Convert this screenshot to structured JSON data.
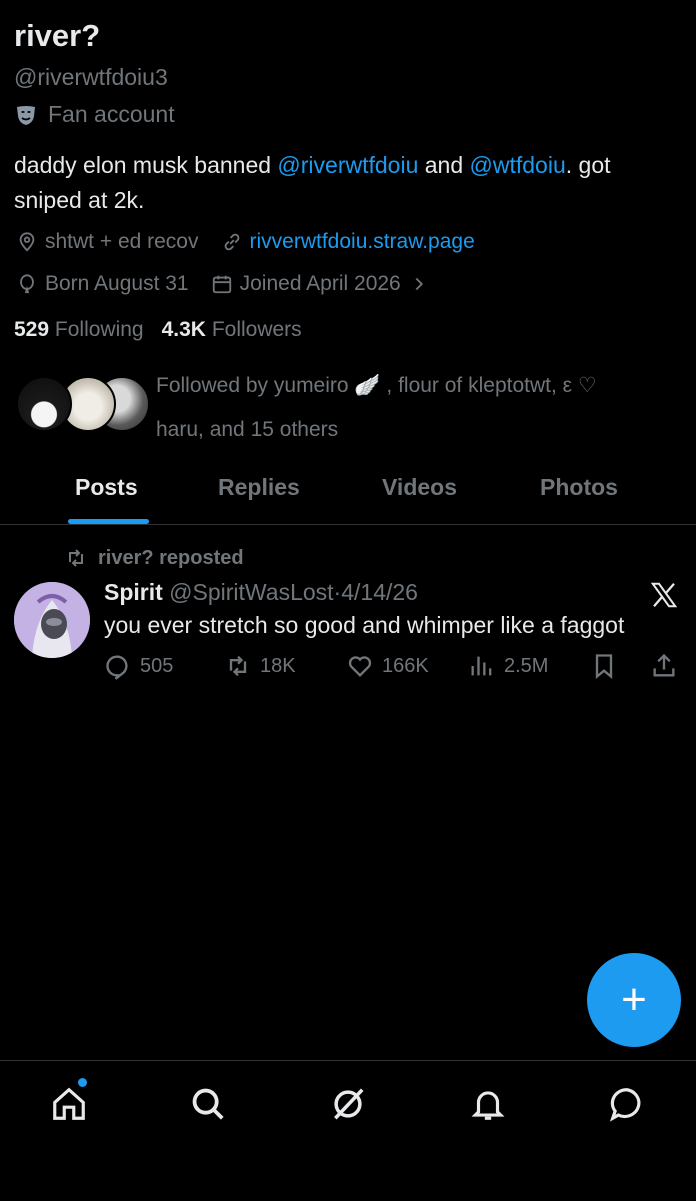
{
  "profile": {
    "name": "river?",
    "handle": "@riverwtfdoiu3",
    "label": "Fan account",
    "bio": {
      "part1": "daddy elon musk banned ",
      "mention1": "@riverwtfdoiu",
      "part2": " and ",
      "mention2": "@wtfdoiu",
      "part3": ". got sniped at 2k."
    },
    "location": "shtwt + ed recov",
    "website": "rivverwtfdoiu.straw.page",
    "birthday": "Born August 31",
    "joined": "Joined April 2026",
    "following_count": "529",
    "following_label": "Following",
    "followers_count": "4.3K",
    "followers_label": "Followers",
    "followed_by_line1": "Followed by yumeiro 🪽 , flour of kleptotwt, ε ♡",
    "followed_by_line2": "haru, and 15 others"
  },
  "tabs": [
    "Posts",
    "Replies",
    "Videos",
    "Photos"
  ],
  "post": {
    "repost_text": "river? reposted",
    "author_name": "Spirit",
    "author_handle": "@SpiritWasLost",
    "separator": "·",
    "date": "4/14/26",
    "text": "you ever stretch so good and whimper like a faggot",
    "replies": "505",
    "reposts": "18K",
    "likes": "166K",
    "views": "2.5M"
  },
  "fab_label": "+",
  "colors": {
    "accent": "#1d9bf0",
    "muted": "#71767b",
    "text": "#e7e9ea",
    "background": "#000000"
  },
  "nav_icons": [
    "home-icon",
    "search-icon",
    "grok-icon",
    "notifications-icon",
    "messages-icon"
  ]
}
